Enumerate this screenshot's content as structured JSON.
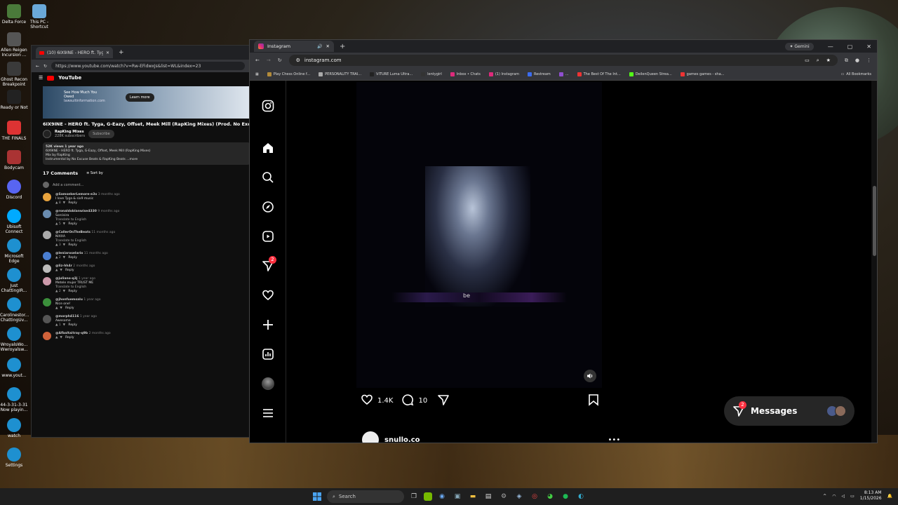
{
  "desktop": {
    "icons": [
      {
        "label": "Delta Force"
      },
      {
        "label": "This PC - Shortcut"
      },
      {
        "label": "Allen Reigen Incursion ..."
      },
      {
        "label": "Ghost Recon Breakpoint"
      },
      {
        "label": "Ready or Not"
      },
      {
        "label": "THE FINALS"
      },
      {
        "label": "Bodycam"
      },
      {
        "label": "Discord"
      },
      {
        "label": "Ubisoft Connect"
      },
      {
        "label": "Microsoft Edge"
      },
      {
        "label": "Just ChattingIR..."
      },
      {
        "label": "Carolinestor... ChattingUv..."
      },
      {
        "label": "WroyalsWo... Wwroyalsw..."
      },
      {
        "label": "www.yout..."
      },
      {
        "label": "44-3-31-3-31 Now playin..."
      },
      {
        "label": "watch"
      },
      {
        "label": "Settings"
      }
    ]
  },
  "youtube": {
    "tab_title": "(10) 6IX9INE - HERO ft. Tyga, G-Ea...",
    "url": "https://www.youtube.com/watch?v=Rw-EFidwxJs&list=WL&index=23",
    "logo_text": "YouTube",
    "ad": {
      "line1": "See How Much You",
      "line2": "Owed",
      "line3": "lawsuitinformation.com",
      "button": "Learn more"
    },
    "video_title": "6IX9INE - HERO ft. Tyga, G-Eazy, Offset, Meek Mill (RapKing Mixes) (Prod. No Excuse B",
    "channel_name": "RapKing Mixes",
    "subscribers": "228K subscribers",
    "subscribe_label": "Subscribe",
    "desc_stats": "52K views  1 year ago",
    "desc_line1": "6IX9INE - HERO ft. Tyga, G-Eazy, Offset, Meek Mill (RapKing Mixes)",
    "desc_line2": "Mix by RapKing",
    "desc_line3": "Instrumental by No Excuse Beats & RapKing Beats ...more",
    "comments_count": "17 Comments",
    "sort_label": "Sort by",
    "add_comment": "Add a comment...",
    "comments": [
      {
        "name": "@SamsekerLemore-e3x",
        "time": "3 months ago",
        "text": "I love Tyga & six9 music",
        "likes": "8",
        "translate": "",
        "color": "#e8a33d"
      },
      {
        "name": "@ronaldoblanwise4330",
        "time": "9 months ago",
        "text": "Sorcisira",
        "likes": "5",
        "translate": "Translate to English",
        "color": "#6a8caf"
      },
      {
        "name": "@CallerOnTheBeats",
        "time": "11 months ago",
        "text": "NIXXA",
        "likes": "3",
        "translate": "Translate to English",
        "color": "#aaa"
      },
      {
        "name": "@leniaroselario",
        "time": "11 months ago",
        "text": "",
        "likes": "2",
        "translate": "",
        "color": "#4a7ed0"
      },
      {
        "name": "@liz-hh4r",
        "time": "2 months ago",
        "text": "",
        "likes": "",
        "translate": "",
        "color": "#bbb"
      },
      {
        "name": "@juliano-q3j",
        "time": "1 year ago",
        "text": "Metele mujer TRUST ME",
        "likes": "2",
        "translate": "Translate to English",
        "color": "#c9a"
      },
      {
        "name": "@jhonfuemsalu",
        "time": "1 year ago",
        "text": "Nice one!",
        "likes": "",
        "translate": "",
        "color": "#3b8f3b"
      },
      {
        "name": "@morph4116",
        "time": "1 year ago",
        "text": "Awesome",
        "likes": "1",
        "translate": "",
        "color": "#555"
      },
      {
        "name": "@Afbaltaitray-q9b",
        "time": "2 months ago",
        "text": "",
        "likes": "",
        "translate": "",
        "color": "#d0623a"
      }
    ],
    "reply_label": "Reply"
  },
  "instagram": {
    "tab_title": "Instagram",
    "url": "instagram.com",
    "gemini_label": "Gemini",
    "bookmarks": [
      {
        "label": "Play Chess Online f...",
        "color": "#b38b3a"
      },
      {
        "label": "PERSONALITY TRAI...",
        "color": "#aaa"
      },
      {
        "label": "VITURE Luma Ultra...",
        "color": "#222"
      },
      {
        "label": "lentygirl",
        "color": "#333"
      },
      {
        "label": "Inbox • Chats",
        "color": "#dd2a7b"
      },
      {
        "label": "(1) Instagram",
        "color": "#dd2a7b"
      },
      {
        "label": "Restream",
        "color": "#3b6cf0"
      },
      {
        "label": "...",
        "color": "#8f4fd0"
      },
      {
        "label": "The Best Of The Int...",
        "color": "#e33"
      },
      {
        "label": "DeilenQueen Strea...",
        "color": "#53fc18"
      },
      {
        "label": "games games - sha...",
        "color": "#e33"
      }
    ],
    "all_bookmarks": "All Bookmarks",
    "post_caption": "be",
    "likes": "1.4K",
    "comments": "10",
    "author": "snullo.co",
    "messages_label": "Messages",
    "messages_badge": "2",
    "nav_badge": "2"
  },
  "taskbar": {
    "search_placeholder": "Search",
    "time": "8:13 AM",
    "date": "1/15/2026"
  }
}
